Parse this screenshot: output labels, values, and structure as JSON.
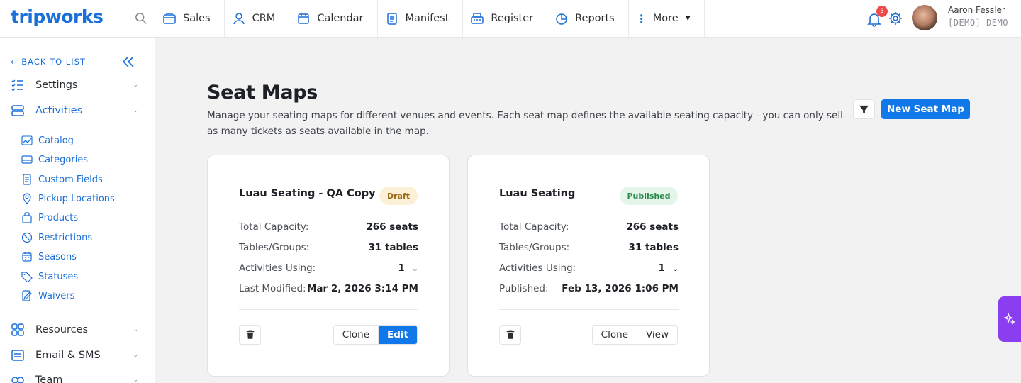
{
  "brand": {
    "logo_text": "tripworks"
  },
  "nav": {
    "items": [
      {
        "label": "Sales",
        "icon": "store-icon"
      },
      {
        "label": "CRM",
        "icon": "user-icon"
      },
      {
        "label": "Calendar",
        "icon": "calendar-icon"
      },
      {
        "label": "Manifest",
        "icon": "clipboard-icon"
      },
      {
        "label": "Register",
        "icon": "register-icon"
      },
      {
        "label": "Reports",
        "icon": "pie-chart-icon"
      },
      {
        "label": "More",
        "icon": "more-icon"
      }
    ]
  },
  "notifications": {
    "count": "3"
  },
  "user": {
    "name": "Aaron Fessler",
    "org": "[DEMO] DEMO"
  },
  "sidebar": {
    "back_label": "← BACK TO LIST",
    "sections": [
      {
        "label": "Settings",
        "icon": "checklist-icon"
      },
      {
        "label": "Activities",
        "icon": "layers-icon"
      },
      {
        "label": "Resources",
        "icon": "grid-icon"
      },
      {
        "label": "Email & SMS",
        "icon": "mail-icon"
      },
      {
        "label": "Team",
        "icon": "team-icon"
      }
    ],
    "activities_items": [
      {
        "label": "Catalog",
        "icon": "catalog-icon"
      },
      {
        "label": "Categories",
        "icon": "categories-icon"
      },
      {
        "label": "Custom Fields",
        "icon": "form-icon"
      },
      {
        "label": "Pickup Locations",
        "icon": "pin-icon"
      },
      {
        "label": "Products",
        "icon": "bag-icon"
      },
      {
        "label": "Restrictions",
        "icon": "ban-icon"
      },
      {
        "label": "Seasons",
        "icon": "calendar-icon"
      },
      {
        "label": "Statuses",
        "icon": "tag-icon"
      },
      {
        "label": "Waivers",
        "icon": "signature-icon"
      }
    ]
  },
  "page": {
    "title": "Seat Maps",
    "description": "Manage your seating maps for different venues and events. Each seat map defines the available seating capacity - you can only sell as many tickets as seats available in the map.",
    "new_button": "New Seat Map"
  },
  "cards": [
    {
      "title": "Luau Seating - QA Copy",
      "status": "Draft",
      "rows": [
        {
          "label": "Total Capacity:",
          "value": "266 seats"
        },
        {
          "label": "Tables/Groups:",
          "value": "31 tables"
        },
        {
          "label": "Activities Using:",
          "value": "1"
        },
        {
          "label": "Last Modified:",
          "value": "Mar 2, 2026 3:14 PM"
        }
      ],
      "secondary_action": "Clone",
      "primary_action": "Edit"
    },
    {
      "title": "Luau Seating",
      "status": "Published",
      "rows": [
        {
          "label": "Total Capacity:",
          "value": "266 seats"
        },
        {
          "label": "Tables/Groups:",
          "value": "31 tables"
        },
        {
          "label": "Activities Using:",
          "value": "1"
        },
        {
          "label": "Published:",
          "value": "Feb 13, 2026 1:06 PM"
        }
      ],
      "secondary_action": "Clone",
      "primary_action": "View"
    }
  ],
  "colors": {
    "accent": "#1078e8",
    "ai": "#8b3df0",
    "badge": "#ef4b4b"
  }
}
